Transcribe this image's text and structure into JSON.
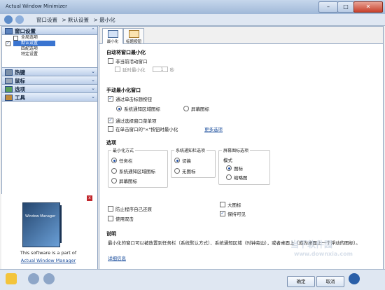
{
  "window": {
    "title": "Actual Window Minimizer",
    "minimize": "–",
    "maximize": "□",
    "close": "✕"
  },
  "breadcrumb": [
    "窗口设置",
    "> 默认设置",
    "> 最小化"
  ],
  "sidebar": {
    "groups": [
      {
        "label": "窗口设置",
        "icon": "window-settings-icon",
        "chevron": "⌃",
        "items": [
          {
            "label": "全局选项",
            "checked": false
          },
          {
            "label": "默认设置",
            "checked": true,
            "selected": true
          },
          {
            "label": "四配选项"
          },
          {
            "label": "特定设置"
          }
        ]
      },
      {
        "label": "热键",
        "icon": "hotkey-icon",
        "chevron": "⌄"
      },
      {
        "label": "鼠标",
        "icon": "mouse-icon",
        "chevron": "⌄"
      },
      {
        "label": "选项",
        "icon": "options-icon",
        "chevron": "⌄"
      },
      {
        "label": "工具",
        "icon": "tools-icon",
        "chevron": "⌄"
      }
    ],
    "ad": {
      "line1": "This software is a part of",
      "line2": "Actual Window Manager",
      "box_text": "Window Manager",
      "close": "x"
    }
  },
  "tabs": [
    {
      "label": "最小化",
      "active": true
    },
    {
      "label": "标题按钮",
      "active": false
    }
  ],
  "auto": {
    "title": "自动将窗口最小化",
    "inactive": "非当前活动窗口",
    "delay": "延时最小化",
    "delay_value": "1",
    "delay_unit": "秒"
  },
  "manual": {
    "title": "手动最小化窗口",
    "via_button": "通过单击标题按钮",
    "to_tray": "系统通知区域图标",
    "to_screen": "屏幕图标",
    "via_menu": "通过选择窗口菜单项",
    "on_close": "在单击窗口的\"×\"按钮时最小化",
    "more_link": "更多选项"
  },
  "options": {
    "title": "选项",
    "minimize_style": {
      "title": "最小化方式",
      "opts": [
        "任务栏",
        "系统通知区域图标",
        "屏幕图标"
      ]
    },
    "tray_options": {
      "title": "系统通知栏选项",
      "opts": [
        "切换",
        "无图标"
      ]
    },
    "screen_options": {
      "title": "屏幕图标选项",
      "mode": "模式",
      "opts": [
        "图标",
        "缩略图"
      ],
      "large": "大图标",
      "keep_visible": "保持可见"
    },
    "prevent_restore": "防止程序自己还原",
    "double_click": "使用双击"
  },
  "description": {
    "title": "说明",
    "text": "最小化的窗口可以被放置到任务栏（系统默认方式）、系统通知区域（时钟旁边），或者桌面上（成为桌面上一个浮动的图标）。",
    "link": "详细信息"
  },
  "footer": {
    "ok": "确定",
    "cancel": "取消"
  },
  "watermark": [
    "当下软件园",
    "www.downxia.com"
  ]
}
